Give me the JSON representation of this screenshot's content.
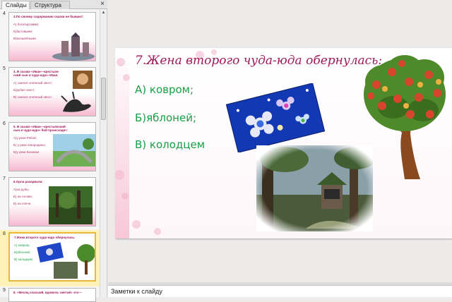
{
  "panel": {
    "tabs": [
      {
        "label": "Слайды",
        "active": true
      },
      {
        "label": "Структура",
        "active": false
      }
    ],
    "close_glyph": "×",
    "thumbnails": [
      {
        "number": "4",
        "lines": [
          "3.По своему содержанию сказки не бывают:",
          "А) богатырскими;",
          "Б)бытовыми;",
          "В)волшебными"
        ]
      },
      {
        "number": "5",
        "lines": [
          "4. В сказке «Иван—крестьян-",
          "ский сын и чудо-юдо» Иван:",
          "А) сжигал огненный хвост;",
          "Б)рубил хвост;",
          "В) сжигал огненный хвост."
        ]
      },
      {
        "number": "6",
        "lines": [
          "5. В сказке «Иван—крестьянский",
          "сын и чудо-юдо» бой происходит:",
          "А)у реки Рябой;",
          "Б) у реки Смородины;",
          "В)у реки Калинки"
        ]
      },
      {
        "number": "7",
        "lines": [
          "6.Орла разорвали:",
          "А)на дубы;",
          "Б) на голове;",
          "В) на плече."
        ]
      },
      {
        "number": "8",
        "lines": [
          "7.Жена второго чудо-юдо обернулась:",
          "А) ковром;",
          "Б)яблоней;",
          "В) колодцем"
        ],
        "selected": true
      },
      {
        "number": "9",
        "lines": [
          "8. «Месяц спасший, вдоволь сметай» это—"
        ]
      }
    ]
  },
  "slide": {
    "title": "7.Жена второго чуда-юда обернулась:",
    "options": [
      "А) ковром;",
      "Б)яблоней;",
      "В) колодцем"
    ]
  },
  "notes": {
    "placeholder": "Заметки к слайду"
  },
  "colors": {
    "title": "#a1185a",
    "options": "#19a046",
    "selection": "#fff2b8"
  }
}
